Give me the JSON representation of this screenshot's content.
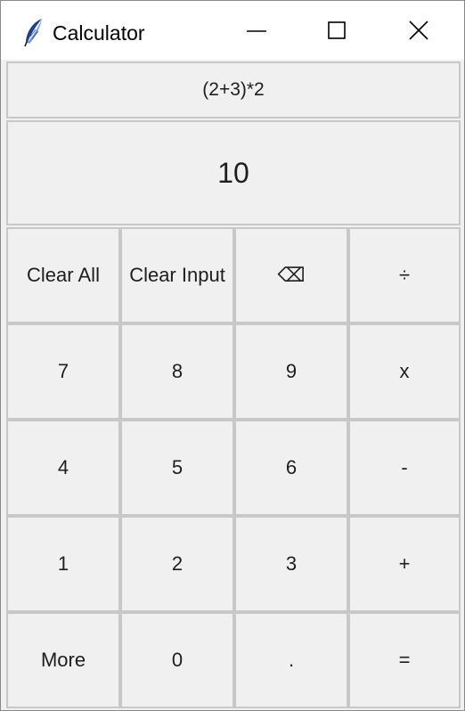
{
  "window": {
    "title": "Calculator",
    "controls": {
      "minimize": "minimize-icon",
      "maximize": "maximize-icon",
      "close": "close-icon"
    }
  },
  "display": {
    "expression": "(2+3)*2",
    "result": "10"
  },
  "keypad": {
    "rows": [
      [
        "Clear All",
        "Clear Input",
        "⌫",
        "÷"
      ],
      [
        "7",
        "8",
        "9",
        "x"
      ],
      [
        "4",
        "5",
        "6",
        "-"
      ],
      [
        "1",
        "2",
        "3",
        "+"
      ],
      [
        "More",
        "0",
        ".",
        "="
      ]
    ]
  },
  "colors": {
    "background": "#f0f0f0",
    "titlebar": "#ffffff",
    "border": "#c8c8c8",
    "text": "#1e1e1e"
  }
}
